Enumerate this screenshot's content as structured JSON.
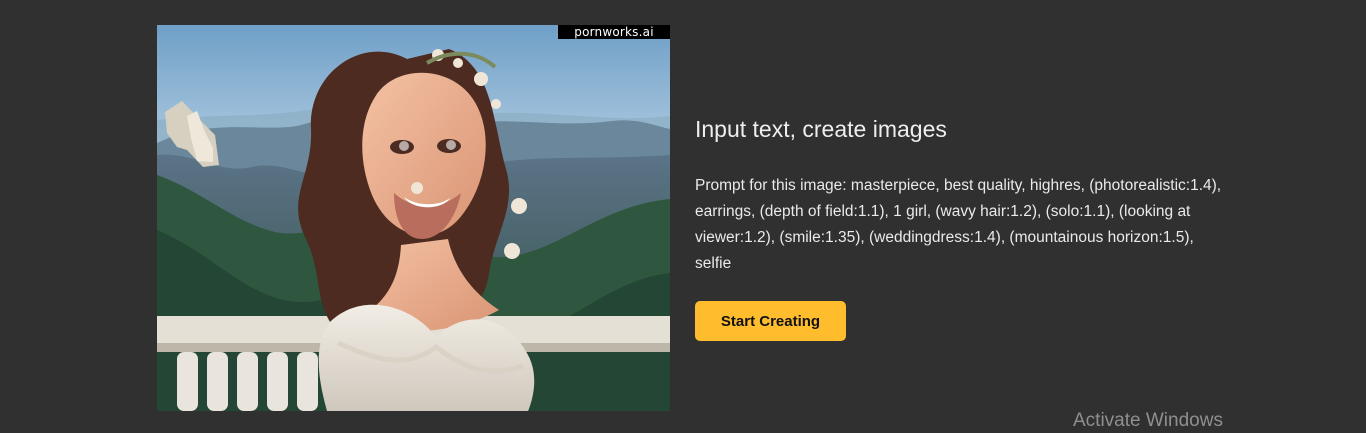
{
  "hero": {
    "watermark": "pornworks.ai",
    "image_icon": "generated-portrait-image"
  },
  "content": {
    "title": "Input text, create images",
    "prompt": "Prompt for this image: masterpiece, best quality, highres, (photorealistic:1.4), earrings, (depth of field:1.1), 1 girl, (wavy hair:1.2), (solo:1.1), (looking at viewer:1.2), (smile:1.35), (weddingdress:1.4), (mountainous horizon:1.5), selfie",
    "button_label": "Start Creating"
  },
  "system": {
    "activate_text": "Activate Windows"
  },
  "colors": {
    "background": "#303030",
    "button": "#ffbd2e",
    "text": "#eeeeee",
    "muted": "#8f8f8f"
  }
}
